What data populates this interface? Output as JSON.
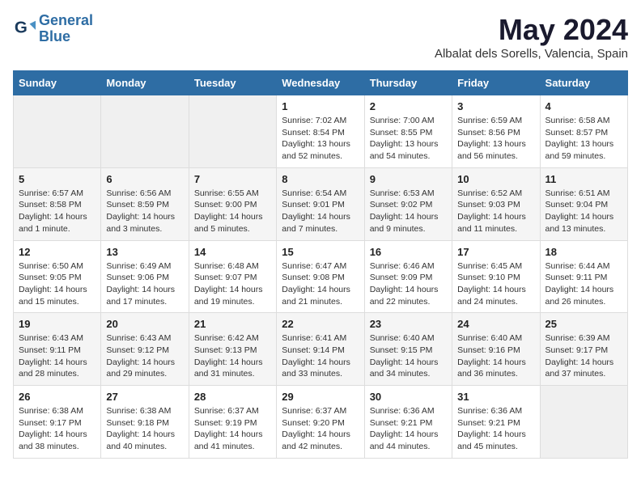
{
  "header": {
    "logo_line1": "General",
    "logo_line2": "Blue",
    "month_title": "May 2024",
    "location": "Albalat dels Sorells, Valencia, Spain"
  },
  "weekdays": [
    "Sunday",
    "Monday",
    "Tuesday",
    "Wednesday",
    "Thursday",
    "Friday",
    "Saturday"
  ],
  "weeks": [
    [
      {
        "day": "",
        "info": ""
      },
      {
        "day": "",
        "info": ""
      },
      {
        "day": "",
        "info": ""
      },
      {
        "day": "1",
        "info": "Sunrise: 7:02 AM\nSunset: 8:54 PM\nDaylight: 13 hours and 52 minutes."
      },
      {
        "day": "2",
        "info": "Sunrise: 7:00 AM\nSunset: 8:55 PM\nDaylight: 13 hours and 54 minutes."
      },
      {
        "day": "3",
        "info": "Sunrise: 6:59 AM\nSunset: 8:56 PM\nDaylight: 13 hours and 56 minutes."
      },
      {
        "day": "4",
        "info": "Sunrise: 6:58 AM\nSunset: 8:57 PM\nDaylight: 13 hours and 59 minutes."
      }
    ],
    [
      {
        "day": "5",
        "info": "Sunrise: 6:57 AM\nSunset: 8:58 PM\nDaylight: 14 hours and 1 minute."
      },
      {
        "day": "6",
        "info": "Sunrise: 6:56 AM\nSunset: 8:59 PM\nDaylight: 14 hours and 3 minutes."
      },
      {
        "day": "7",
        "info": "Sunrise: 6:55 AM\nSunset: 9:00 PM\nDaylight: 14 hours and 5 minutes."
      },
      {
        "day": "8",
        "info": "Sunrise: 6:54 AM\nSunset: 9:01 PM\nDaylight: 14 hours and 7 minutes."
      },
      {
        "day": "9",
        "info": "Sunrise: 6:53 AM\nSunset: 9:02 PM\nDaylight: 14 hours and 9 minutes."
      },
      {
        "day": "10",
        "info": "Sunrise: 6:52 AM\nSunset: 9:03 PM\nDaylight: 14 hours and 11 minutes."
      },
      {
        "day": "11",
        "info": "Sunrise: 6:51 AM\nSunset: 9:04 PM\nDaylight: 14 hours and 13 minutes."
      }
    ],
    [
      {
        "day": "12",
        "info": "Sunrise: 6:50 AM\nSunset: 9:05 PM\nDaylight: 14 hours and 15 minutes."
      },
      {
        "day": "13",
        "info": "Sunrise: 6:49 AM\nSunset: 9:06 PM\nDaylight: 14 hours and 17 minutes."
      },
      {
        "day": "14",
        "info": "Sunrise: 6:48 AM\nSunset: 9:07 PM\nDaylight: 14 hours and 19 minutes."
      },
      {
        "day": "15",
        "info": "Sunrise: 6:47 AM\nSunset: 9:08 PM\nDaylight: 14 hours and 21 minutes."
      },
      {
        "day": "16",
        "info": "Sunrise: 6:46 AM\nSunset: 9:09 PM\nDaylight: 14 hours and 22 minutes."
      },
      {
        "day": "17",
        "info": "Sunrise: 6:45 AM\nSunset: 9:10 PM\nDaylight: 14 hours and 24 minutes."
      },
      {
        "day": "18",
        "info": "Sunrise: 6:44 AM\nSunset: 9:11 PM\nDaylight: 14 hours and 26 minutes."
      }
    ],
    [
      {
        "day": "19",
        "info": "Sunrise: 6:43 AM\nSunset: 9:11 PM\nDaylight: 14 hours and 28 minutes."
      },
      {
        "day": "20",
        "info": "Sunrise: 6:43 AM\nSunset: 9:12 PM\nDaylight: 14 hours and 29 minutes."
      },
      {
        "day": "21",
        "info": "Sunrise: 6:42 AM\nSunset: 9:13 PM\nDaylight: 14 hours and 31 minutes."
      },
      {
        "day": "22",
        "info": "Sunrise: 6:41 AM\nSunset: 9:14 PM\nDaylight: 14 hours and 33 minutes."
      },
      {
        "day": "23",
        "info": "Sunrise: 6:40 AM\nSunset: 9:15 PM\nDaylight: 14 hours and 34 minutes."
      },
      {
        "day": "24",
        "info": "Sunrise: 6:40 AM\nSunset: 9:16 PM\nDaylight: 14 hours and 36 minutes."
      },
      {
        "day": "25",
        "info": "Sunrise: 6:39 AM\nSunset: 9:17 PM\nDaylight: 14 hours and 37 minutes."
      }
    ],
    [
      {
        "day": "26",
        "info": "Sunrise: 6:38 AM\nSunset: 9:17 PM\nDaylight: 14 hours and 38 minutes."
      },
      {
        "day": "27",
        "info": "Sunrise: 6:38 AM\nSunset: 9:18 PM\nDaylight: 14 hours and 40 minutes."
      },
      {
        "day": "28",
        "info": "Sunrise: 6:37 AM\nSunset: 9:19 PM\nDaylight: 14 hours and 41 minutes."
      },
      {
        "day": "29",
        "info": "Sunrise: 6:37 AM\nSunset: 9:20 PM\nDaylight: 14 hours and 42 minutes."
      },
      {
        "day": "30",
        "info": "Sunrise: 6:36 AM\nSunset: 9:21 PM\nDaylight: 14 hours and 44 minutes."
      },
      {
        "day": "31",
        "info": "Sunrise: 6:36 AM\nSunset: 9:21 PM\nDaylight: 14 hours and 45 minutes."
      },
      {
        "day": "",
        "info": ""
      }
    ]
  ]
}
